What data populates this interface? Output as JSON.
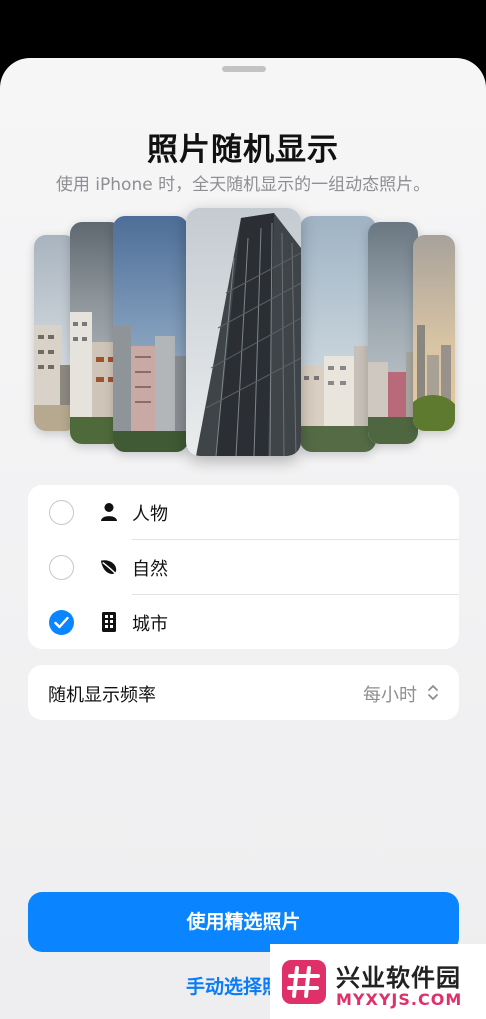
{
  "sheet": {
    "title": "照片随机显示",
    "subtitle": "使用 iPhone 时，全天随机显示的一组动态照片。"
  },
  "gallery": {
    "cards": [
      "street-city-photo",
      "cloudy-city-photo",
      "blue-sky-towers-photo",
      "skyscraper-photo",
      "overcast-towers-photo",
      "stormy-city-photo",
      "sunset-city-photo"
    ]
  },
  "options": [
    {
      "label": "人物",
      "icon": "person-icon",
      "selected": false
    },
    {
      "label": "自然",
      "icon": "leaf-icon",
      "selected": false
    },
    {
      "label": "城市",
      "icon": "building-icon",
      "selected": true
    }
  ],
  "frequency": {
    "label": "随机显示频率",
    "value": "每小时"
  },
  "actions": {
    "primary": "使用精选照片",
    "secondary": "手动选择照片"
  },
  "watermark": {
    "title": "兴业软件园",
    "url": "MYXYJS.COM"
  },
  "colors": {
    "accent": "#0a84ff",
    "watermark": "#e0306a"
  }
}
